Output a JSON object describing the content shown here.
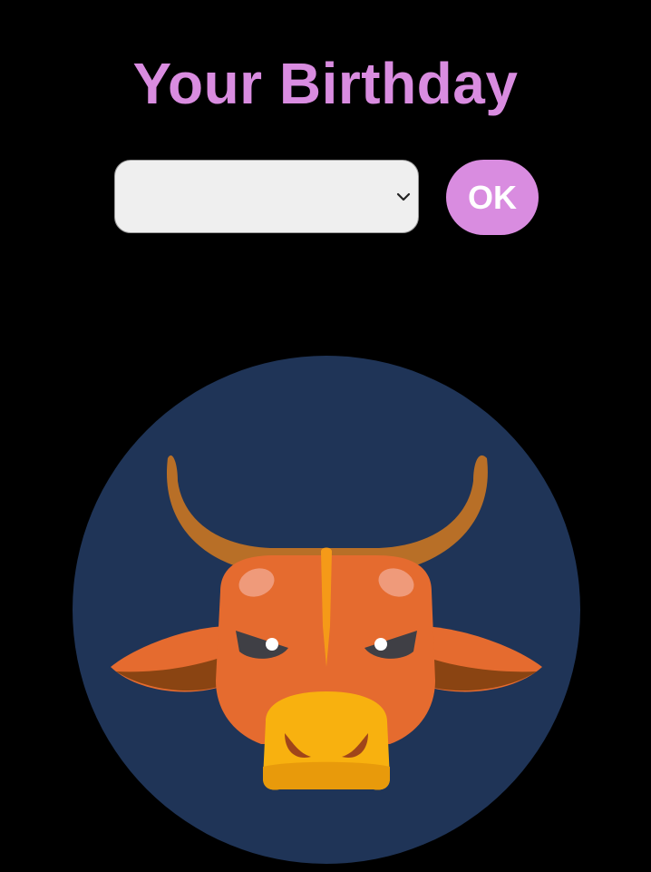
{
  "header": {
    "title": "Your Birthday"
  },
  "form": {
    "select_value": "",
    "ok_label": "OK"
  },
  "image": {
    "icon": "ox-zodiac-icon"
  },
  "colors": {
    "background": "#000000",
    "accent": "#d98ce0",
    "circle": "#1f3457",
    "face": "#e56b2f",
    "horns": "#b86f27",
    "muzzle": "#f8b10f"
  }
}
